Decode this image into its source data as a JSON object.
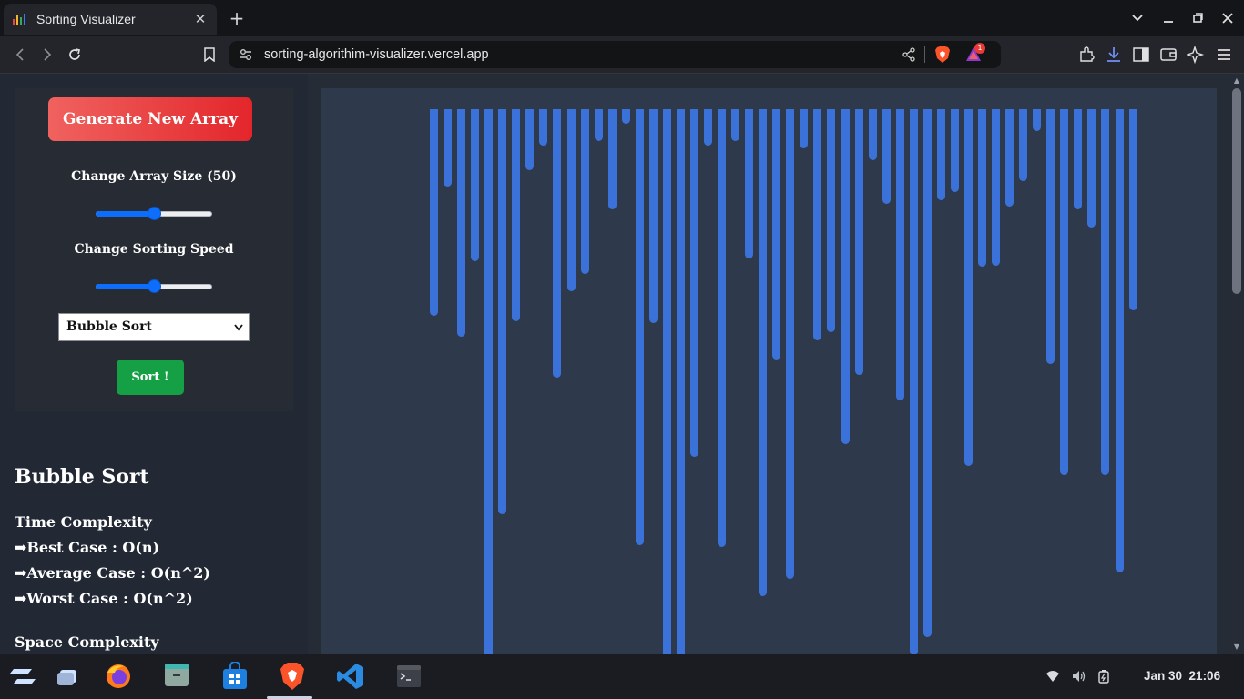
{
  "browser": {
    "tab_title": "Sorting Visualizer",
    "tab_close": "✕",
    "new_tab": "+",
    "url": "sorting-algorithim-visualizer.vercel.app",
    "rewards_badge": "1",
    "accent_brave": "#fb542b"
  },
  "controls": {
    "generate_label": "Generate New Array",
    "size_label": "Change Array Size (50)",
    "size_slider_fraction": 0.5,
    "speed_label": "Change Sorting Speed",
    "speed_slider_fraction": 0.5,
    "algorithm_selected": "Bubble Sort",
    "sort_label": "Sort !"
  },
  "info": {
    "algorithm_title": "Bubble Sort",
    "time_heading": "Time Complexity",
    "best": "➡Best Case : O(n)",
    "average": "➡Average Case : O(n^2)",
    "worst": "➡Worst Case : O(n^2)",
    "space_heading": "Space Complexity"
  },
  "array_values": [
    227,
    85,
    250,
    167,
    620,
    445,
    233,
    67,
    40,
    295,
    200,
    181,
    35,
    110,
    16,
    479,
    235,
    620,
    620,
    382,
    40,
    481,
    35,
    164,
    535,
    275,
    516,
    43,
    254,
    245,
    368,
    292,
    56,
    104,
    320,
    600,
    580,
    100,
    91,
    392,
    173,
    172,
    107,
    79,
    24,
    280,
    402,
    110,
    130,
    402,
    509,
    221
  ],
  "colors": {
    "bar": "#3b72d9",
    "visualizer_bg": "#2e3a4b",
    "generate_button": "#e3262b",
    "sort_button": "#15a046"
  },
  "taskbar": {
    "date": "Jan 30",
    "time": "21:06"
  }
}
